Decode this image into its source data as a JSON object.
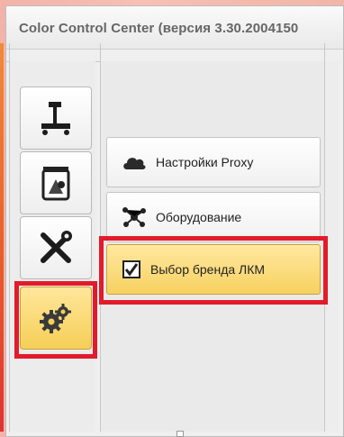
{
  "window": {
    "title": "Color Control Center (версия 3.30.2004150"
  },
  "sidebar": {
    "items": [
      {
        "icon": "printer-station-icon",
        "active": false
      },
      {
        "icon": "paint-can-icon",
        "active": false
      },
      {
        "icon": "tools-icon",
        "active": false
      },
      {
        "icon": "gears-icon",
        "active": true
      }
    ]
  },
  "menu": {
    "items": [
      {
        "label": "Настройки Proxy",
        "icon": "cloud-icon",
        "active": false
      },
      {
        "label": "Оборудование",
        "icon": "hardware-network-icon",
        "active": false
      },
      {
        "label": "Выбор бренда ЛКМ",
        "icon": "checkbox-icon",
        "active": true
      }
    ]
  },
  "colors": {
    "active_fill": "#f6cf58",
    "highlight": "#e21b2a",
    "accent_edge": "#e85a2a"
  }
}
